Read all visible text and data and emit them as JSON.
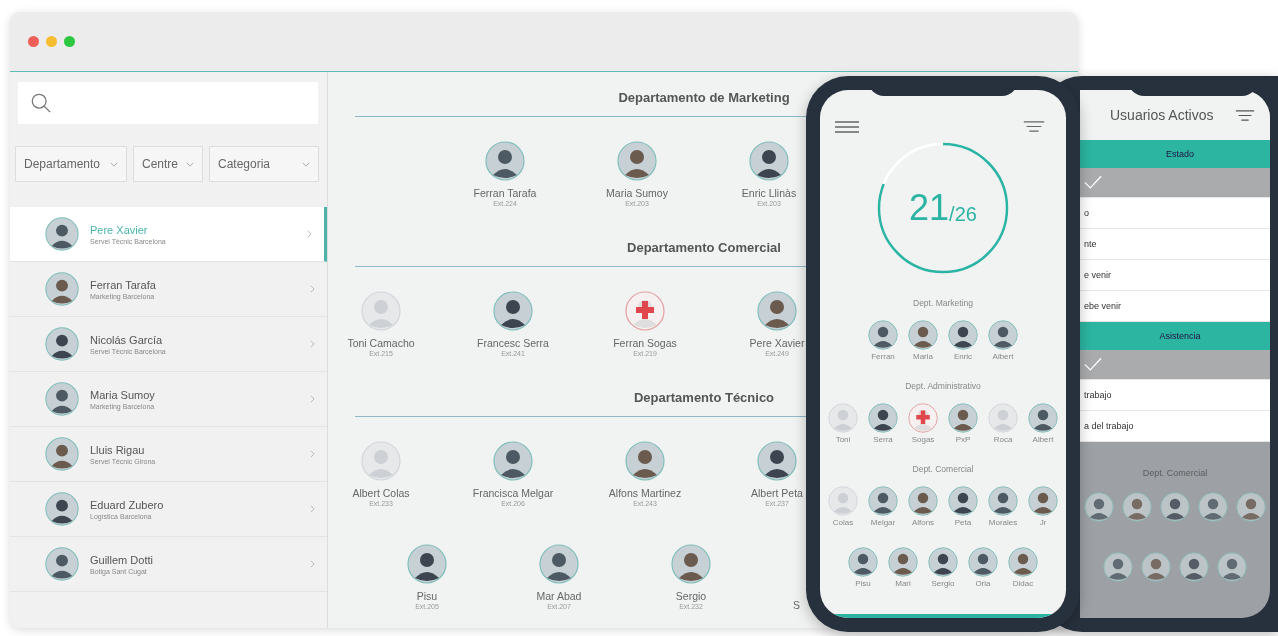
{
  "window": {
    "controls": [
      {
        "color": "#ee5f57"
      },
      {
        "color": "#f5bd2f"
      },
      {
        "color": "#2dc840"
      }
    ]
  },
  "filters": [
    {
      "label": "Departamento"
    },
    {
      "label": "Centre"
    },
    {
      "label": "Categoria"
    }
  ],
  "employees": [
    {
      "name": "Pere Xavier",
      "subtitle": "Servei Tècnic Barcelona",
      "selected": true,
      "kind": "present"
    },
    {
      "name": "Ferran Tarafa",
      "subtitle": "Marketing Barcelona",
      "selected": false,
      "kind": "present"
    },
    {
      "name": "Nicolás García",
      "subtitle": "Servei Tècnic Barcelona",
      "selected": false,
      "kind": "present"
    },
    {
      "name": "Maria Sumoy",
      "subtitle": "Marketing Barcelona",
      "selected": false,
      "kind": "present"
    },
    {
      "name": "Lluis Rigau",
      "subtitle": "Servei Tècnic Girona",
      "selected": false,
      "kind": "present"
    },
    {
      "name": "Eduard Zubero",
      "subtitle": "Logística Barcelona",
      "selected": false,
      "kind": "present"
    },
    {
      "name": "Guillem Dotti",
      "subtitle": "Botiga Sant Cugat",
      "selected": false,
      "kind": "present"
    }
  ],
  "departments": [
    {
      "title": "Departamento de Marketing",
      "rows": [
        {
          "kind": "indented",
          "people": [
            {
              "name": "Ferran Tarafa",
              "ext": "Ext.224",
              "kind": "present"
            },
            {
              "name": "Maria Sumoy",
              "ext": "Ext.203",
              "kind": "present"
            },
            {
              "name": "Enric Llinàs",
              "ext": "Ext.203",
              "kind": "present"
            }
          ]
        }
      ]
    },
    {
      "title": "Departamento Comercial",
      "rows": [
        {
          "kind": "full",
          "people": [
            {
              "name": "Toni Camacho",
              "ext": "Ext.215",
              "kind": "absent"
            },
            {
              "name": "Francesc Serra",
              "ext": "Ext.241",
              "kind": "present"
            },
            {
              "name": "Ferran Sogas",
              "ext": "Ext.219",
              "kind": "sick"
            },
            {
              "name": "Pere Xavier",
              "ext": "Ext.249",
              "kind": "present"
            }
          ]
        }
      ]
    },
    {
      "title": "Departamento Técnico",
      "rows": [
        {
          "kind": "full",
          "people": [
            {
              "name": "Albert Colas",
              "ext": "Ext.233",
              "kind": "absent"
            },
            {
              "name": "Francisca Melgar",
              "ext": "Ext.206",
              "kind": "present"
            },
            {
              "name": "Alfons Martinez",
              "ext": "Ext.243",
              "kind": "present"
            },
            {
              "name": "Albert Peta",
              "ext": "Ext.237",
              "kind": "present"
            }
          ]
        },
        {
          "kind": "offset",
          "people": [
            {
              "name": "Pisu",
              "ext": "Ext.205",
              "kind": "present"
            },
            {
              "name": "Mar Abad",
              "ext": "Ext.207",
              "kind": "present"
            },
            {
              "name": "Sergio",
              "ext": "Ext.232",
              "kind": "present"
            },
            {
              "name": "S"
            }
          ]
        }
      ]
    }
  ],
  "summary": {
    "present": "21",
    "total": "/26",
    "groups": [
      {
        "title": "Dept. Marketing",
        "people": [
          {
            "name": "Ferran",
            "kind": "present"
          },
          {
            "name": "Maria",
            "kind": "present"
          },
          {
            "name": "Enric",
            "kind": "present"
          },
          {
            "name": "Albert",
            "kind": "present"
          }
        ]
      },
      {
        "title": "Dept. Administrativo",
        "people": [
          {
            "name": "Toni",
            "kind": "absent"
          },
          {
            "name": "Serra",
            "kind": "present"
          },
          {
            "name": "Sogas",
            "kind": "sick"
          },
          {
            "name": "PxP",
            "kind": "present"
          },
          {
            "name": "Roca",
            "kind": "absent"
          },
          {
            "name": "Albert",
            "kind": "present"
          }
        ]
      },
      {
        "title": "Dept. Comercial",
        "people": [
          {
            "name": "Colas",
            "kind": "absent"
          },
          {
            "name": "Melgar",
            "kind": "present"
          },
          {
            "name": "Alfons",
            "kind": "present"
          },
          {
            "name": "Peta",
            "kind": "present"
          },
          {
            "name": "Morales",
            "kind": "present"
          },
          {
            "name": "Jr",
            "kind": "present"
          }
        ]
      },
      {
        "people": [
          {
            "name": "Pisu",
            "kind": "present"
          },
          {
            "name": "Mari",
            "kind": "present"
          },
          {
            "name": "Sergio",
            "kind": "present"
          },
          {
            "name": "Oria",
            "kind": "present"
          },
          {
            "name": "Didac",
            "kind": "present"
          }
        ]
      }
    ]
  },
  "filter_panel": {
    "title": "Usuarios Activos",
    "sections": [
      {
        "title": "Estado",
        "options": [
          {
            "selected": true
          },
          {
            "label": "o",
            "selected": false
          },
          {
            "label": "nte",
            "selected": false
          },
          {
            "label": "e venir",
            "selected": false
          },
          {
            "label": "ebe venir",
            "selected": false
          }
        ]
      },
      {
        "title": "Asistencia",
        "options": [
          {
            "selected": true
          },
          {
            "label": "trabajo",
            "selected": false
          },
          {
            "label": "a del trabajo",
            "selected": false
          }
        ]
      }
    ],
    "behind": {
      "title": "Dept. Comercial",
      "rows": [
        [
          {
            "kind": "present"
          },
          {
            "kind": "present"
          },
          {
            "kind": "present"
          },
          {
            "kind": "present"
          },
          {
            "kind": "present"
          }
        ],
        [
          {
            "kind": "present"
          },
          {
            "kind": "present"
          },
          {
            "kind": "present"
          },
          {
            "kind": "present"
          }
        ]
      ]
    }
  }
}
